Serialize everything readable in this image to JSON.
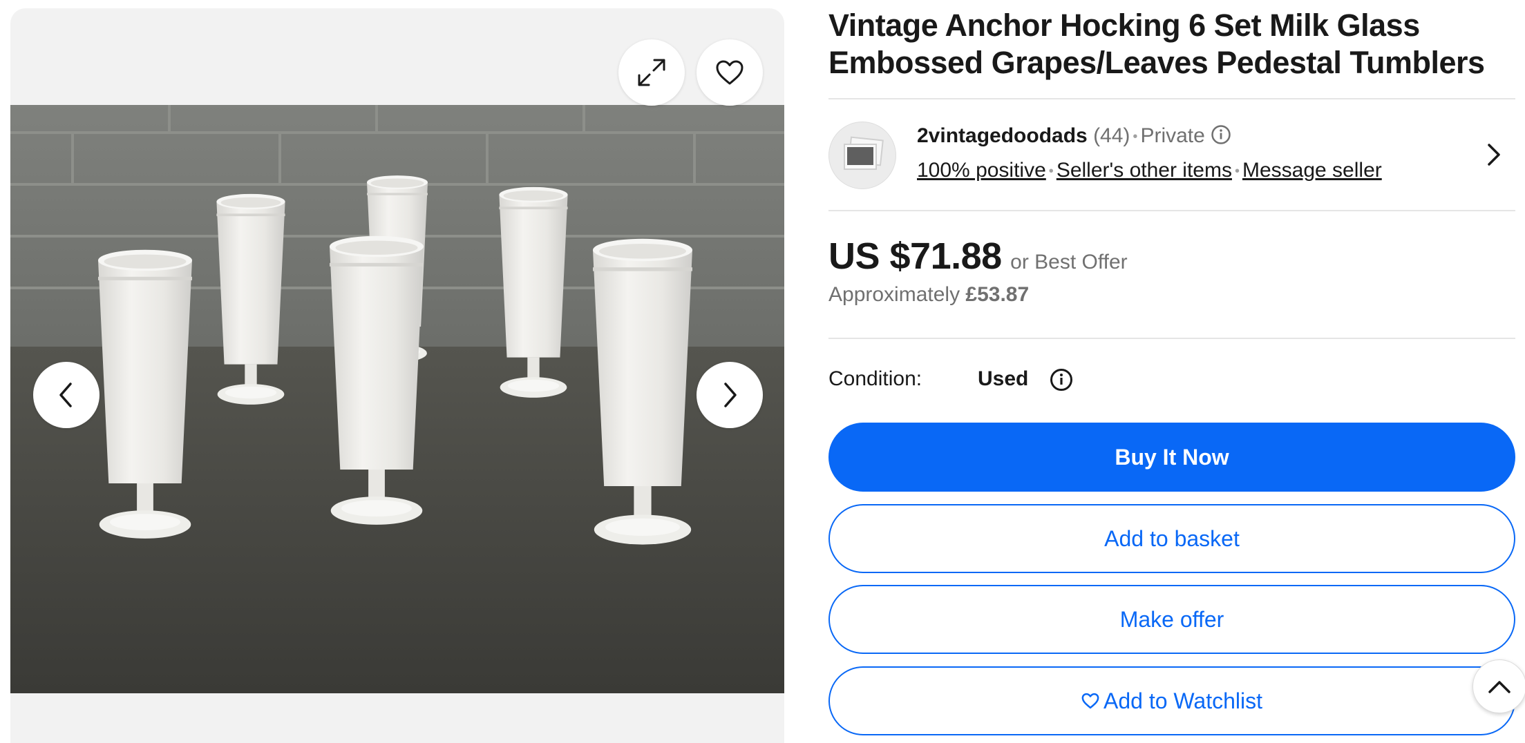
{
  "gallery": {
    "image_alt": "Six white milk glass pedestal tumblers with embossed grapes on a dark countertop",
    "icons": {
      "expand": "expand-icon",
      "favorite": "heart-icon",
      "previous": "chevron-left-icon",
      "next": "chevron-right-icon"
    }
  },
  "listing": {
    "title": "Vintage Anchor Hocking 6 Set Milk Glass Embossed Grapes/Leaves Pedestal Tumblers"
  },
  "seller": {
    "name": "2vintagedoodads",
    "feedback_count": "(44)",
    "type": "Private",
    "positive": "100% positive",
    "other_items": "Seller's other items",
    "message": "Message seller"
  },
  "pricing": {
    "price": "US $71.88",
    "best_offer": "or Best Offer",
    "approx_prefix": "Approximately",
    "approx_value": "£53.87"
  },
  "condition": {
    "label": "Condition:",
    "value": "Used"
  },
  "actions": {
    "buy_now": "Buy It Now",
    "add_to_basket": "Add to basket",
    "make_offer": "Make offer",
    "add_to_watchlist": "Add to Watchlist"
  },
  "colors": {
    "primary": "#0968f6",
    "text": "#191919",
    "muted": "#707070",
    "gallery_bg": "#f2f2f2"
  }
}
